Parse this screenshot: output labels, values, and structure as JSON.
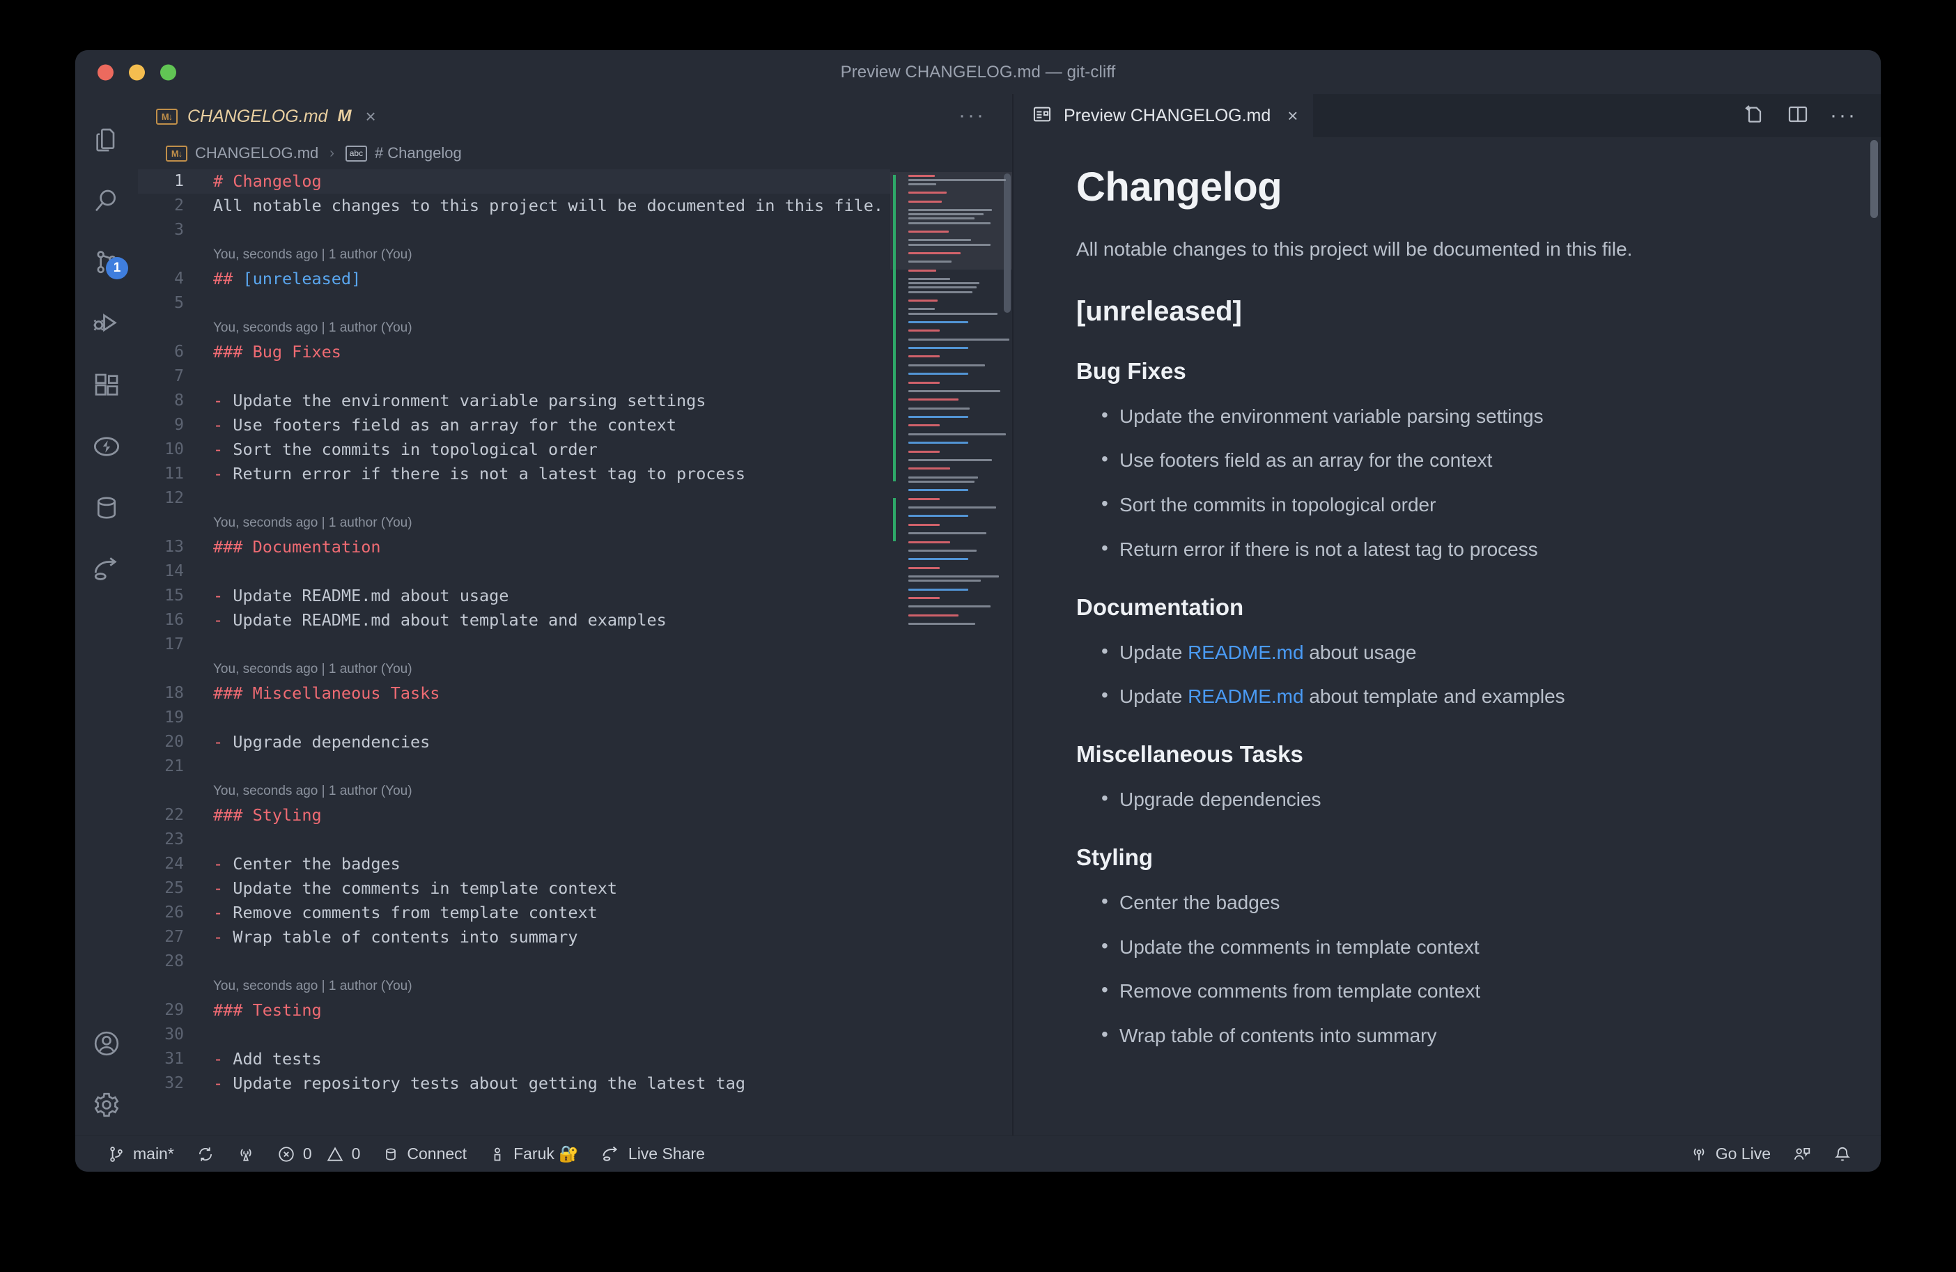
{
  "window": {
    "title": "Preview CHANGELOG.md — git-cliff",
    "traffic_lights": [
      "close-red",
      "minimize-yellow",
      "maximize-green"
    ]
  },
  "activity_bar": {
    "items": [
      {
        "name": "explorer",
        "icon": "files-icon",
        "badge": null
      },
      {
        "name": "search",
        "icon": "search-icon",
        "badge": null
      },
      {
        "name": "source-control",
        "icon": "source-control-icon",
        "badge": "1"
      },
      {
        "name": "run-and-debug",
        "icon": "run-debug-icon",
        "badge": null
      },
      {
        "name": "extensions",
        "icon": "extensions-icon",
        "badge": null
      },
      {
        "name": "thunder-client",
        "icon": "lightning-icon",
        "badge": null
      },
      {
        "name": "database",
        "icon": "database-icon",
        "badge": null
      },
      {
        "name": "live-share",
        "icon": "live-share-icon",
        "badge": null
      },
      {
        "name": "accounts",
        "icon": "account-icon",
        "badge": null
      },
      {
        "name": "settings",
        "icon": "gear-icon",
        "badge": null
      }
    ]
  },
  "editor": {
    "tab": {
      "label": "CHANGELOG.md",
      "dirty_marker": "M",
      "close": "×",
      "file_icon": "M↓"
    },
    "more_actions": "···",
    "breadcrumb": {
      "file": "CHANGELOG.md",
      "separator": "›",
      "symbol": "# Changelog",
      "symbol_icon": "abc"
    },
    "lines": [
      {
        "n": "1",
        "added": false,
        "current": true,
        "segments": [
          {
            "t": "# Changelog",
            "c": "h-red"
          }
        ]
      },
      {
        "n": "2",
        "added": false,
        "wrap": true,
        "segments": [
          {
            "t": "All notable changes to this project will be documented in this file.",
            "c": ""
          }
        ]
      },
      {
        "n": "3",
        "added": false,
        "segments": []
      },
      {
        "blame": "You, seconds ago | 1 author (You)"
      },
      {
        "n": "4",
        "added": true,
        "segments": [
          {
            "t": "## ",
            "c": "h-red"
          },
          {
            "t": "[unreleased]",
            "c": "h-blue"
          }
        ]
      },
      {
        "n": "5",
        "added": true,
        "segments": []
      },
      {
        "blame": "You, seconds ago | 1 author (You)"
      },
      {
        "n": "6",
        "added": true,
        "segments": [
          {
            "t": "### Bug Fixes",
            "c": "h-red"
          }
        ]
      },
      {
        "n": "7",
        "added": true,
        "segments": []
      },
      {
        "n": "8",
        "added": true,
        "segments": [
          {
            "t": "- ",
            "c": "dash"
          },
          {
            "t": "Update the environment variable parsing settings",
            "c": ""
          }
        ]
      },
      {
        "n": "9",
        "added": true,
        "segments": [
          {
            "t": "- ",
            "c": "dash"
          },
          {
            "t": "Use footers field as an array for the context",
            "c": ""
          }
        ]
      },
      {
        "n": "10",
        "added": true,
        "segments": [
          {
            "t": "- ",
            "c": "dash"
          },
          {
            "t": "Sort the commits in topological order",
            "c": ""
          }
        ]
      },
      {
        "n": "11",
        "added": true,
        "segments": [
          {
            "t": "- ",
            "c": "dash"
          },
          {
            "t": "Return error if there is not a latest tag to process",
            "c": ""
          }
        ]
      },
      {
        "n": "12",
        "added": true,
        "segments": []
      },
      {
        "blame": "You, seconds ago | 1 author (You)"
      },
      {
        "n": "13",
        "added": true,
        "segments": [
          {
            "t": "### Documentation",
            "c": "h-red"
          }
        ]
      },
      {
        "n": "14",
        "added": true,
        "segments": []
      },
      {
        "n": "15",
        "added": true,
        "segments": [
          {
            "t": "- ",
            "c": "dash"
          },
          {
            "t": "Update README.md about usage",
            "c": ""
          }
        ]
      },
      {
        "n": "16",
        "added": true,
        "segments": [
          {
            "t": "- ",
            "c": "dash"
          },
          {
            "t": "Update README.md about template and examples",
            "c": ""
          }
        ]
      },
      {
        "n": "17",
        "added": true,
        "segments": []
      },
      {
        "blame": "You, seconds ago | 1 author (You)"
      },
      {
        "n": "18",
        "added": true,
        "segments": [
          {
            "t": "### Miscellaneous Tasks",
            "c": "h-red"
          }
        ]
      },
      {
        "n": "19",
        "added": true,
        "segments": []
      },
      {
        "n": "20",
        "added": true,
        "segments": [
          {
            "t": "- ",
            "c": "dash"
          },
          {
            "t": "Upgrade dependencies",
            "c": ""
          }
        ]
      },
      {
        "n": "21",
        "added": true,
        "segments": []
      },
      {
        "blame": "You, seconds ago | 1 author (You)"
      },
      {
        "n": "22",
        "added": true,
        "segments": [
          {
            "t": "### Styling",
            "c": "h-red"
          }
        ]
      },
      {
        "n": "23",
        "added": true,
        "segments": []
      },
      {
        "n": "24",
        "added": true,
        "segments": [
          {
            "t": "- ",
            "c": "dash"
          },
          {
            "t": "Center the badges",
            "c": ""
          }
        ]
      },
      {
        "n": "25",
        "added": true,
        "segments": [
          {
            "t": "- ",
            "c": "dash"
          },
          {
            "t": "Update the comments in template context",
            "c": ""
          }
        ]
      },
      {
        "n": "26",
        "added": true,
        "segments": [
          {
            "t": "- ",
            "c": "dash"
          },
          {
            "t": "Remove comments from template context",
            "c": ""
          }
        ]
      },
      {
        "n": "27",
        "added": true,
        "segments": [
          {
            "t": "- ",
            "c": "dash"
          },
          {
            "t": "Wrap table of contents into summary",
            "c": ""
          }
        ]
      },
      {
        "n": "28",
        "added": true,
        "segments": []
      },
      {
        "blame": "You, seconds ago | 1 author (You)"
      },
      {
        "n": "29",
        "added": true,
        "segments": [
          {
            "t": "### Testing",
            "c": "h-red"
          }
        ]
      },
      {
        "n": "30",
        "added": true,
        "segments": []
      },
      {
        "n": "31",
        "added": true,
        "segments": [
          {
            "t": "- ",
            "c": "dash"
          },
          {
            "t": "Add tests",
            "c": ""
          }
        ]
      },
      {
        "n": "32",
        "added": true,
        "segments": [
          {
            "t": "- ",
            "c": "dash"
          },
          {
            "t": "Update repository tests about getting the latest tag",
            "c": ""
          }
        ]
      }
    ]
  },
  "preview": {
    "tab": {
      "label": "Preview CHANGELOG.md",
      "close": "×",
      "icon": "preview-icon"
    },
    "actions": [
      "open-source-icon",
      "split-editor-icon",
      "more-actions-icon"
    ],
    "more_actions": "···",
    "document": {
      "h1": "Changelog",
      "intro": "All notable changes to this project will be documented in this file.",
      "sections": [
        {
          "heading": "[unreleased]",
          "level": 2,
          "subsections": [
            {
              "heading": "Bug Fixes",
              "items": [
                [
                  {
                    "t": "Update the environment variable parsing settings"
                  }
                ],
                [
                  {
                    "t": "Use footers field as an array for the context"
                  }
                ],
                [
                  {
                    "t": "Sort the commits in topological order"
                  }
                ],
                [
                  {
                    "t": "Return error if there is not a latest tag to process"
                  }
                ]
              ]
            },
            {
              "heading": "Documentation",
              "items": [
                [
                  {
                    "t": "Update "
                  },
                  {
                    "t": "README.md",
                    "link": true
                  },
                  {
                    "t": " about usage"
                  }
                ],
                [
                  {
                    "t": "Update "
                  },
                  {
                    "t": "README.md",
                    "link": true
                  },
                  {
                    "t": " about template and examples"
                  }
                ]
              ]
            },
            {
              "heading": "Miscellaneous Tasks",
              "items": [
                [
                  {
                    "t": "Upgrade dependencies"
                  }
                ]
              ]
            },
            {
              "heading": "Styling",
              "items": [
                [
                  {
                    "t": "Center the badges"
                  }
                ],
                [
                  {
                    "t": "Update the comments in template context"
                  }
                ],
                [
                  {
                    "t": "Remove comments from template context"
                  }
                ],
                [
                  {
                    "t": "Wrap table of contents into summary"
                  }
                ]
              ]
            }
          ]
        }
      ]
    }
  },
  "status_bar": {
    "left": [
      {
        "name": "branch",
        "icon": "git-branch-icon",
        "label": "main*"
      },
      {
        "name": "sync",
        "icon": "sync-icon",
        "label": ""
      },
      {
        "name": "remote-tunnel",
        "icon": "radio-tower-icon",
        "label": ""
      },
      {
        "name": "problems",
        "icon": "error-warning-icons",
        "label": "0",
        "label2": "0"
      },
      {
        "name": "database-connect",
        "icon": "database-icon",
        "label": "Connect"
      },
      {
        "name": "user",
        "icon": "person-icon",
        "label": "Faruk 🔐"
      },
      {
        "name": "live-share",
        "icon": "live-share-icon",
        "label": "Live Share"
      }
    ],
    "right": [
      {
        "name": "go-live",
        "icon": "broadcast-icon",
        "label": "Go Live"
      },
      {
        "name": "feedback",
        "icon": "feedback-icon",
        "label": ""
      },
      {
        "name": "notifications",
        "icon": "bell-icon",
        "label": ""
      }
    ]
  },
  "colors": {
    "bg": "#272c36",
    "accent_blue": "#4a9bf5",
    "heading_red": "#ef6b73",
    "link_blue": "#5aa7f0",
    "git_added": "#2ea868",
    "tab_active_text": "#e9cfa0",
    "badge": "#3f7ede"
  }
}
